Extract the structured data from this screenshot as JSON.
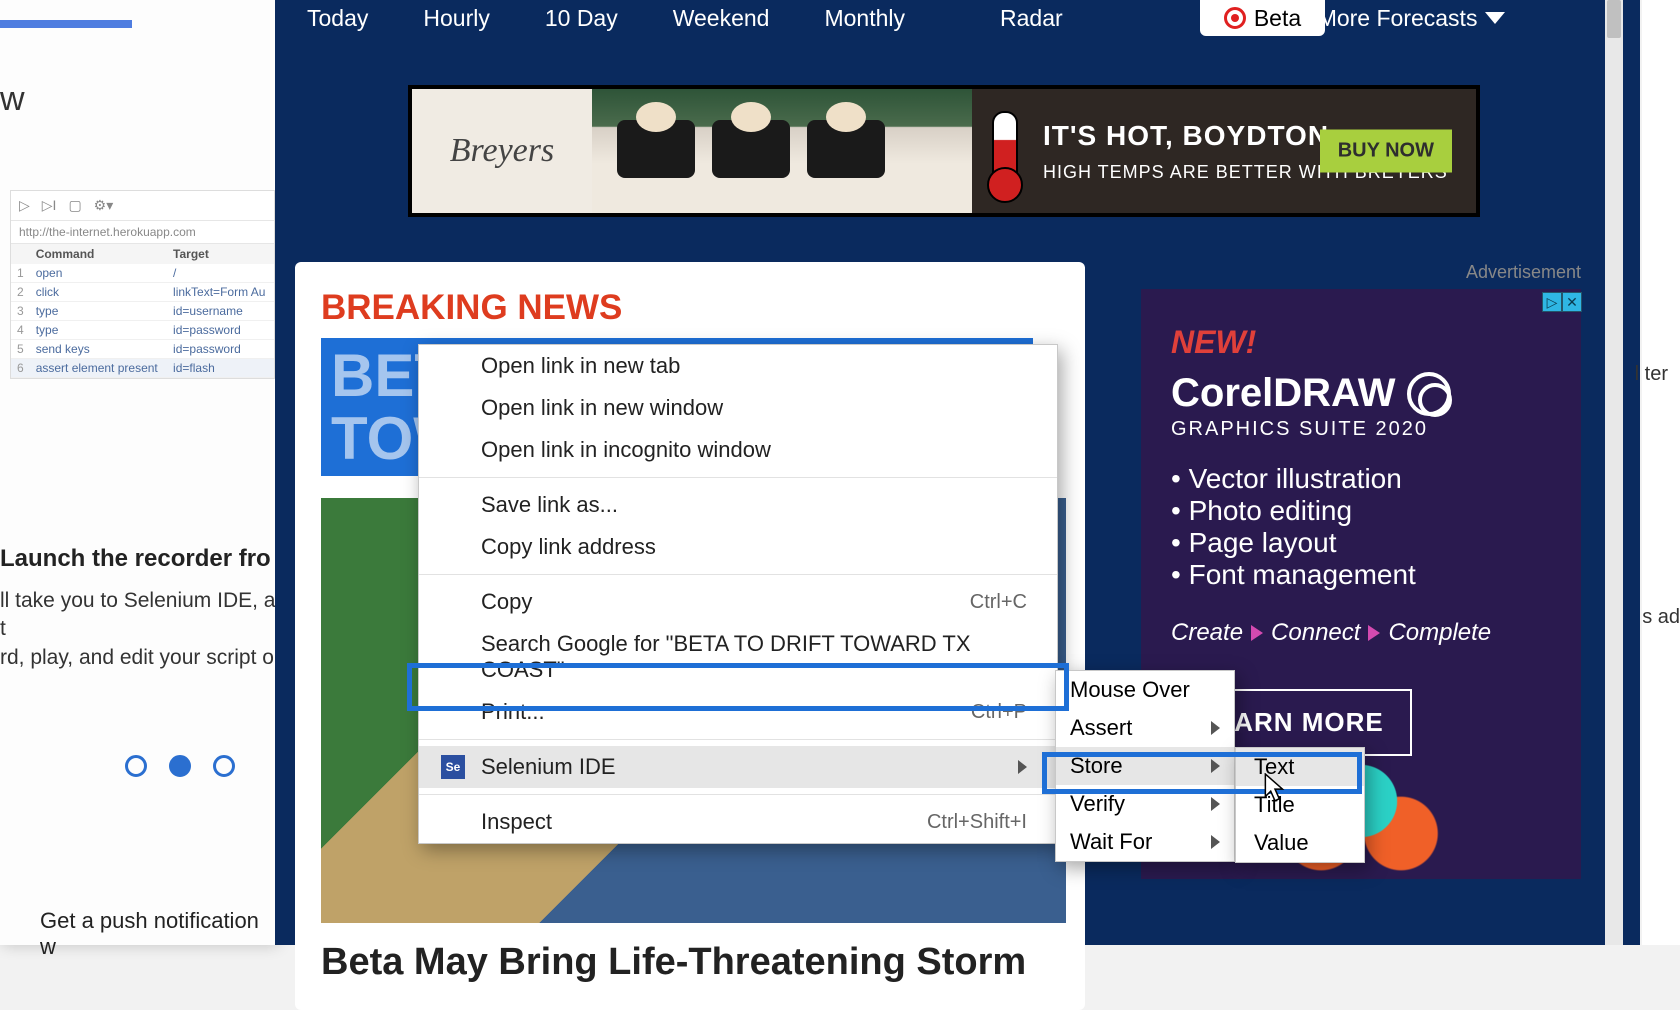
{
  "nav": {
    "today": "Today",
    "hourly": "Hourly",
    "tenday": "10 Day",
    "weekend": "Weekend",
    "monthly": "Monthly",
    "radar": "Radar",
    "beta": "Beta",
    "more": "More Forecasts"
  },
  "banner": {
    "brand": "Breyers",
    "heading": "IT'S HOT, BOYDTON",
    "sub": "HIGH TEMPS ARE BETTER WITH BREYERS",
    "cta": "BUY NOW"
  },
  "content": {
    "breaking": "BREAKING NEWS",
    "headline": "BETA TO DRIFT TOWARD TX COAST",
    "article_title": "Beta May Bring Life-Threatening Storm"
  },
  "sidebar_ad": {
    "label": "Advertisement",
    "new": "NEW!",
    "brand": "CorelDRAW",
    "suite": "GRAPHICS SUITE 2020",
    "features": [
      "Vector illustration",
      "Photo editing",
      "Page layout",
      "Font management"
    ],
    "tag_create": "Create",
    "tag_connect": "Connect",
    "tag_complete": "Complete",
    "learn": "LEARN MORE"
  },
  "left_panel": {
    "w": "w",
    "url": "http://the-internet.herokuapp.com",
    "headers": {
      "cmd": "Command",
      "tgt": "Target"
    },
    "rows": [
      {
        "n": "1",
        "cmd": "open",
        "tgt": "/"
      },
      {
        "n": "2",
        "cmd": "click",
        "tgt": "linkText=Form Au"
      },
      {
        "n": "3",
        "cmd": "type",
        "tgt": "id=username"
      },
      {
        "n": "4",
        "cmd": "type",
        "tgt": "id=password"
      },
      {
        "n": "5",
        "cmd": "send keys",
        "tgt": "id=password"
      },
      {
        "n": "6",
        "cmd": "assert element present",
        "tgt": "id=flash"
      }
    ],
    "launch_h": "Launch the recorder fro",
    "launch_p1": "ll take you to Selenium IDE, a t",
    "launch_p2": "rd, play, and edit your script o",
    "bottom": "Get a push notification w"
  },
  "context_menu": {
    "open_tab": "Open link in new tab",
    "open_win": "Open link in new window",
    "open_inc": "Open link in incognito window",
    "save_as": "Save link as...",
    "copy_addr": "Copy link address",
    "copy": "Copy",
    "copy_sc": "Ctrl+C",
    "search": "Search Google for \"BETA TO DRIFT TOWARD TX COAST\"",
    "print": "Print...",
    "print_sc": "Ctrl+P",
    "selenium": "Selenium IDE",
    "inspect": "Inspect",
    "inspect_sc": "Ctrl+Shift+I"
  },
  "submenu1": {
    "mouse_over": "Mouse Over",
    "assert": "Assert",
    "store": "Store",
    "verify": "Verify",
    "wait_for": "Wait For"
  },
  "submenu2": {
    "text": "Text",
    "title": "Title",
    "value": "Value"
  },
  "right_frame": {
    "t1": "l ter",
    "t2": "s ad"
  }
}
